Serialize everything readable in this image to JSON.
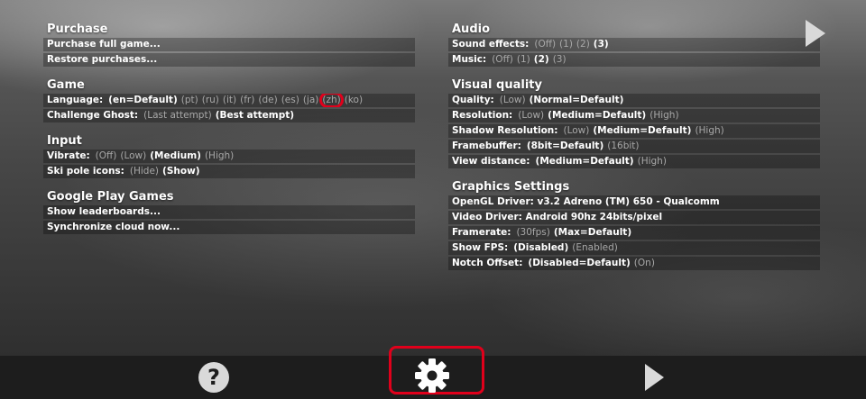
{
  "left": {
    "purchase": {
      "title": "Purchase",
      "full_game": "Purchase full game...",
      "restore": "Restore purchases..."
    },
    "game": {
      "title": "Game",
      "language": {
        "label": "Language:",
        "options": [
          "(en=Default)",
          "(pt)",
          "(ru)",
          "(it)",
          "(fr)",
          "(de)",
          "(es)",
          "(ja)",
          "(zh)",
          "(ko)"
        ],
        "selected_index": 0,
        "highlighted_index": 8
      },
      "ghost": {
        "label": "Challenge Ghost:",
        "options": [
          "(Last attempt)",
          "(Best attempt)"
        ],
        "selected_index": 1
      }
    },
    "input": {
      "title": "Input",
      "vibrate": {
        "label": "Vibrate:",
        "options": [
          "(Off)",
          "(Low)",
          "(Medium)",
          "(High)"
        ],
        "selected_index": 2
      },
      "ski_pole": {
        "label": "Ski pole icons:",
        "options": [
          "(Hide)",
          "(Show)"
        ],
        "selected_index": 1
      }
    },
    "gpg": {
      "title": "Google Play Games",
      "leaderboards": "Show leaderboards...",
      "sync": "Synchronize cloud now..."
    }
  },
  "right": {
    "audio": {
      "title": "Audio",
      "sound": {
        "label": "Sound effects:",
        "options": [
          "(Off)",
          "(1)",
          "(2)",
          "(3)"
        ],
        "selected_index": 3
      },
      "music": {
        "label": "Music:",
        "options": [
          "(Off)",
          "(1)",
          "(2)",
          "(3)"
        ],
        "selected_index": 2
      }
    },
    "visual": {
      "title": "Visual quality",
      "quality": {
        "label": "Quality:",
        "options": [
          "(Low)",
          "(Normal=Default)"
        ],
        "selected_index": 1
      },
      "resolution": {
        "label": "Resolution:",
        "options": [
          "(Low)",
          "(Medium=Default)",
          "(High)"
        ],
        "selected_index": 1
      },
      "shadow": {
        "label": "Shadow Resolution:",
        "options": [
          "(Low)",
          "(Medium=Default)",
          "(High)"
        ],
        "selected_index": 1
      },
      "framebuffer": {
        "label": "Framebuffer:",
        "options": [
          "(8bit=Default)",
          "(16bit)"
        ],
        "selected_index": 0
      },
      "view": {
        "label": "View distance:",
        "options": [
          "(Medium=Default)",
          "(High)"
        ],
        "selected_index": 0
      }
    },
    "graphics": {
      "title": "Graphics Settings",
      "opengl": "OpenGL Driver: v3.2 Adreno (TM) 650 - Qualcomm",
      "video": "Video Driver: Android 90hz 24bits/pixel",
      "framerate": {
        "label": "Framerate:",
        "options": [
          "(30fps)",
          "(Max=Default)"
        ],
        "selected_index": 1
      },
      "fps": {
        "label": "Show FPS:",
        "options": [
          "(Disabled)",
          "(Enabled)"
        ],
        "selected_index": 0
      },
      "notch": {
        "label": "Notch Offset:",
        "options": [
          "(Disabled=Default)",
          "(On)"
        ],
        "selected_index": 0
      }
    }
  },
  "bottom": {
    "help_symbol": "?",
    "icons": [
      "play-icon",
      "help-icon",
      "gear-icon",
      "play-icon"
    ]
  },
  "colors": {
    "highlight": "#e0001b",
    "selected_text": "#ffffff",
    "unselected_text": "#a8a8a8",
    "bottom_bar": "#1d1d1d"
  }
}
